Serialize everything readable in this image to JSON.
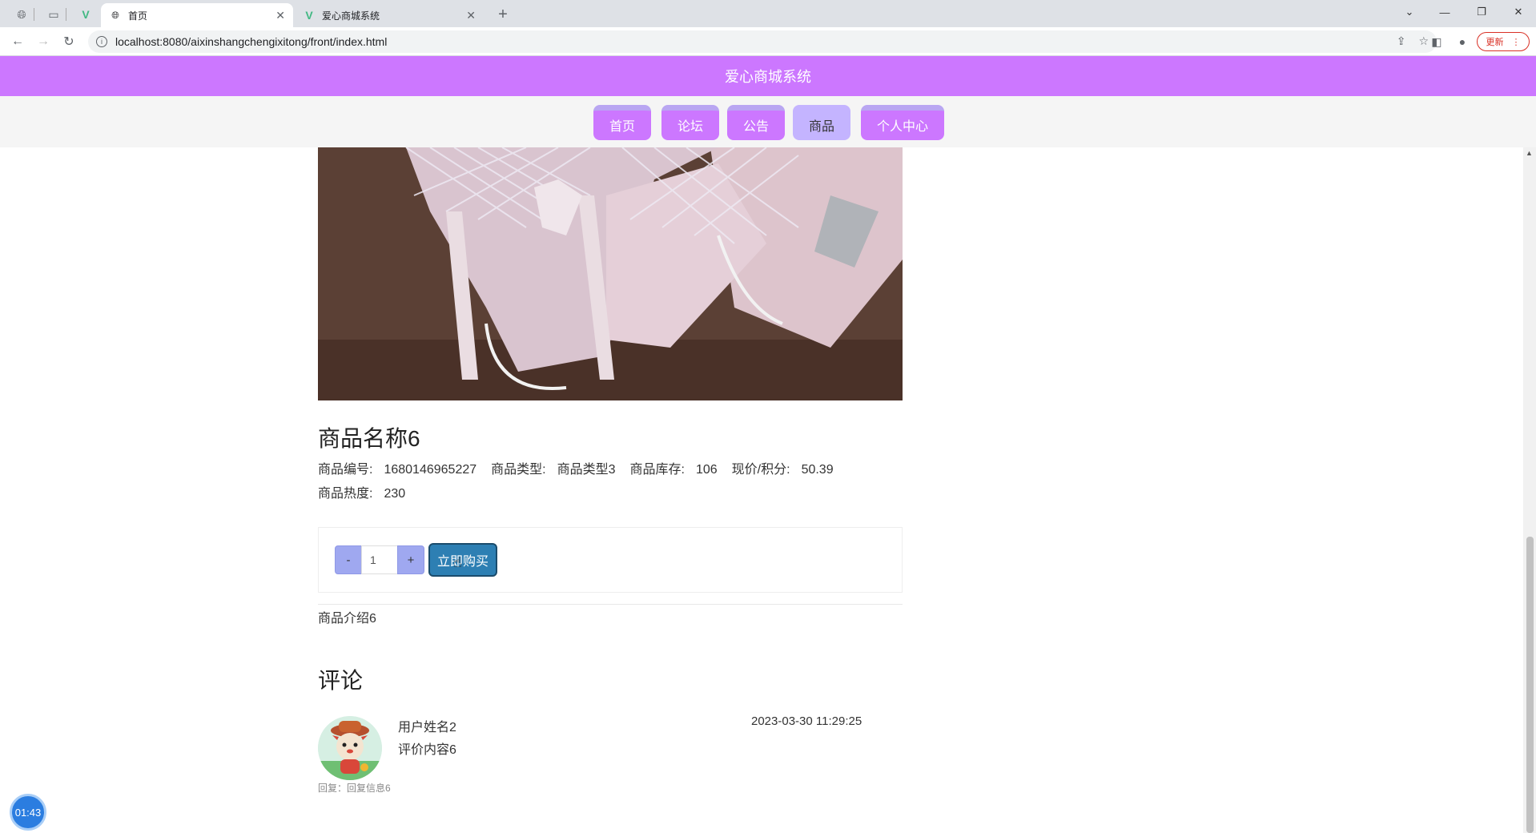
{
  "browser": {
    "tabs": [
      {
        "title": "首页",
        "active": true
      },
      {
        "title": "爱心商城系统",
        "active": false
      }
    ],
    "url": "localhost:8080/aixinshangchengixitong/front/index.html",
    "update_label": "更新"
  },
  "site": {
    "title": "爱心商城系统",
    "nav": [
      {
        "label": "首页"
      },
      {
        "label": "论坛"
      },
      {
        "label": "公告"
      },
      {
        "label": "商品",
        "active": true
      },
      {
        "label": "个人中心"
      }
    ]
  },
  "product": {
    "name": "商品名称6",
    "code_label": "商品编号:",
    "code": "1680146965227",
    "type_label": "商品类型:",
    "type": "商品类型3",
    "stock_label": "商品库存:",
    "stock": "106",
    "price_label": "现价/积分:",
    "price": "50.39",
    "heat_label": "商品热度:",
    "heat": "230",
    "quantity": "1",
    "minus_label": "-",
    "plus_label": "+",
    "buy_label": "立即购买",
    "intro": "商品介绍6"
  },
  "comments": {
    "title": "评论",
    "items": [
      {
        "user": "用户姓名2",
        "time": "2023-03-30 11:29:25",
        "content": "评价内容6",
        "reply": "回复：回复信息6"
      }
    ]
  },
  "timer": "01:43"
}
